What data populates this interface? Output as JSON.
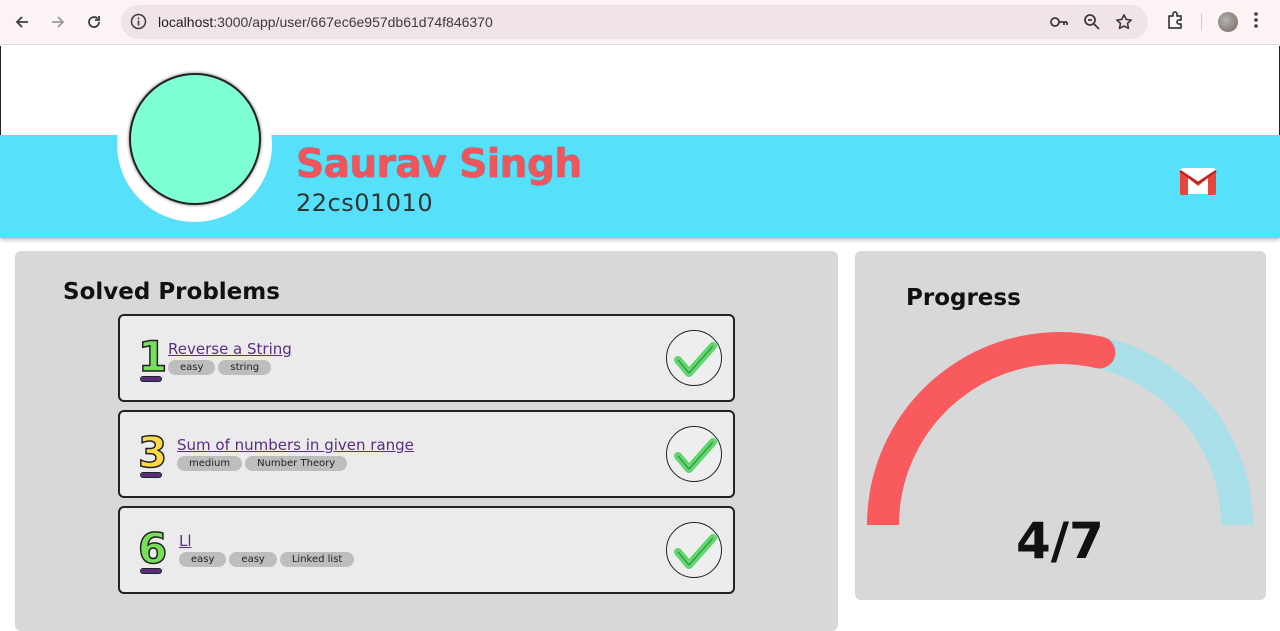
{
  "browser": {
    "url_host": "localhost",
    "url_rest": ":3000/app/user/667ec6e957db61d74f846370"
  },
  "profile": {
    "name": "Saurav Singh",
    "roll": "22cs01010",
    "avatar_color": "#7fffd4"
  },
  "solved": {
    "title": "Solved Problems",
    "items": [
      {
        "number": "1",
        "number_color": "#77e05a",
        "title": "Reverse a String",
        "tags": [
          "easy",
          "string"
        ]
      },
      {
        "number": "3",
        "number_color": "#ffd84a",
        "title": "Sum of numbers in given range",
        "tags": [
          "medium",
          "Number Theory"
        ]
      },
      {
        "number": "6",
        "number_color": "#77e05a",
        "title": "Ll",
        "tags": [
          "easy",
          "easy",
          "Linked list"
        ]
      }
    ]
  },
  "progress": {
    "title": "Progress",
    "label": "4/7",
    "solved": 4,
    "total": 7,
    "fill_color": "#f85a5e",
    "track_color": "#a9dfe9"
  },
  "colors": {
    "header_blue": "#56e0fa",
    "name_red": "#f2545b",
    "panel_grey": "#d8d8d8",
    "link_purple": "#5a2d82"
  }
}
